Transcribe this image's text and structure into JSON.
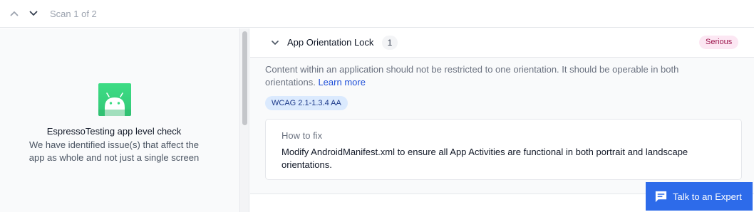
{
  "toolbar": {
    "scan_label": "Scan 1 of 2"
  },
  "left": {
    "title": "EspressoTesting app level check",
    "description": "We have identified issue(s) that affect the app as whole and not just a single screen"
  },
  "issue": {
    "title": "App Orientation Lock",
    "count": "1",
    "severity": "Serious",
    "description": "Content within an application should not be restricted to one orientation. It should be operable in both orientations.",
    "learn_more": "Learn more",
    "wcag_tag": "WCAG 2.1-1.3.4 AA",
    "fix": {
      "title": "How to fix",
      "text": "Modify AndroidManifest.xml to ensure all App Activities are functional in both portrait and landscape orientations."
    }
  },
  "expert_button": {
    "label": "Talk to an Expert"
  },
  "colors": {
    "accent": "#2d6bea",
    "android_green": "#3ddc84",
    "serious_bg": "#fce7f3",
    "serious_text": "#9d174d",
    "wcag_bg": "#dbeafe"
  },
  "icons": [
    "chevron-up-icon",
    "chevron-down-icon",
    "android-icon",
    "chat-icon"
  ]
}
